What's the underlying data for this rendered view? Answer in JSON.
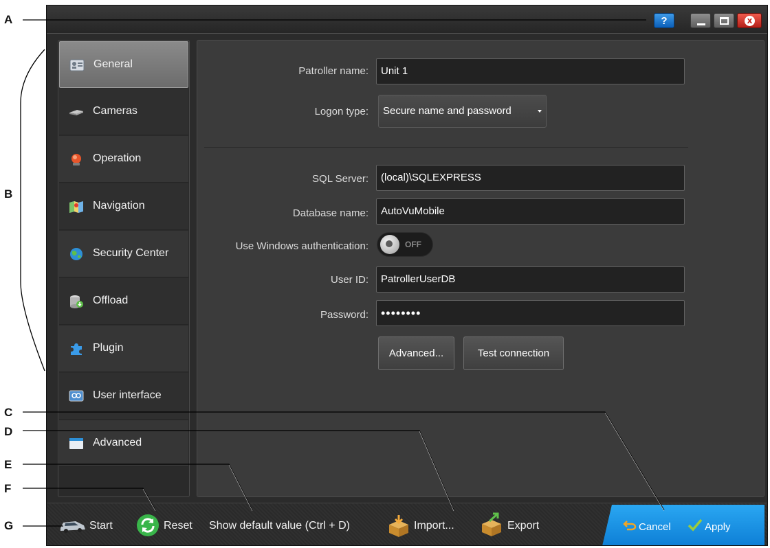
{
  "callouts": [
    "A",
    "B",
    "C",
    "D",
    "E",
    "F",
    "G"
  ],
  "window_controls": {
    "help": "?",
    "close": "x"
  },
  "sidebar": {
    "items": [
      {
        "label": "General",
        "icon": "id-card-icon"
      },
      {
        "label": "Cameras",
        "icon": "camera-icon"
      },
      {
        "label": "Operation",
        "icon": "beacon-icon"
      },
      {
        "label": "Navigation",
        "icon": "map-icon"
      },
      {
        "label": "Security Center",
        "icon": "globe-icon"
      },
      {
        "label": "Offload",
        "icon": "database-download-icon"
      },
      {
        "label": "Plugin",
        "icon": "puzzle-icon"
      },
      {
        "label": "User interface",
        "icon": "user-interface-icon"
      },
      {
        "label": "Advanced",
        "icon": "window-icon"
      }
    ],
    "selected": "General"
  },
  "form": {
    "patroller_name": {
      "label": "Patroller name:",
      "value": "Unit 1"
    },
    "logon_type": {
      "label": "Logon type:",
      "value": "Secure name and password"
    },
    "sql_server": {
      "label": "SQL Server:",
      "value": "(local)\\SQLEXPRESS"
    },
    "database_name": {
      "label": "Database name:",
      "value": "AutoVuMobile"
    },
    "windows_auth": {
      "label": "Use Windows authentication:",
      "state": "OFF"
    },
    "user_id": {
      "label": "User ID:",
      "value": "PatrollerUserDB"
    },
    "password": {
      "label": "Password:",
      "value": "••••••••"
    },
    "advanced_button": "Advanced...",
    "test_connection_button": "Test connection"
  },
  "bottom_bar": {
    "start": "Start",
    "reset": "Reset",
    "show_default": "Show default value (Ctrl + D)",
    "import": "Import...",
    "export": "Export",
    "cancel": "Cancel",
    "apply": "Apply"
  },
  "colors": {
    "accent_blue": "#1a8fe3",
    "window_bg": "#2b2b2b",
    "panel_bg": "#3b3b3b",
    "close_red": "#d9352a",
    "apply_check_green": "#9ccc3c",
    "cancel_orange": "#f5a623"
  }
}
